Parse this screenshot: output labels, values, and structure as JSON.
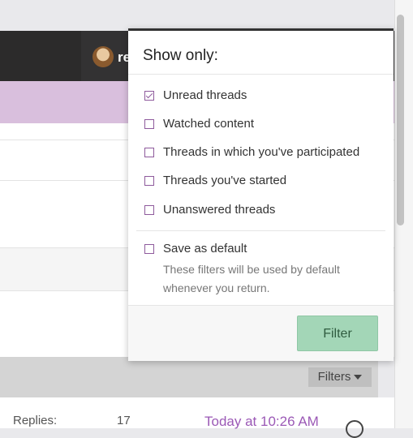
{
  "header": {
    "username_partial": "re"
  },
  "filter_menu": {
    "title": "Show only:",
    "options": [
      {
        "label": "Unread threads",
        "checked": true
      },
      {
        "label": "Watched content",
        "checked": false
      },
      {
        "label": "Threads in which you've participated",
        "checked": false
      },
      {
        "label": "Threads you've started",
        "checked": false
      },
      {
        "label": "Unanswered threads",
        "checked": false
      }
    ],
    "save_default": {
      "label": "Save as default",
      "checked": false,
      "description": "These filters will be used by default whenever you return."
    },
    "filter_button": "Filter"
  },
  "list": {
    "filters_label": "Filters",
    "replies_label": "Replies:",
    "replies_value": "17",
    "latest": "Today at 10:26 AM"
  },
  "colors": {
    "accent": "#9b59b6",
    "filter_button_bg": "#a3d6b7",
    "header_bg": "#2c2b2b"
  }
}
